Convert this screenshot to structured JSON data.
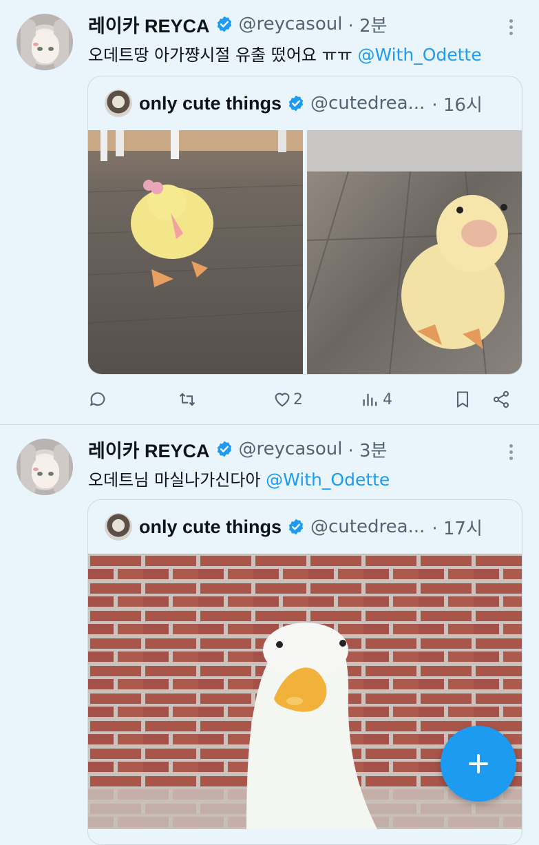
{
  "tweets": [
    {
      "display_name": "레이카 REYCA",
      "handle": "@reycasoul",
      "time": "· 2분",
      "text": "오데트땅 아가쨩시절 유출 떴어요 ㅠㅠ ",
      "mention": "@With_Odette",
      "quote": {
        "display_name": "only cute things",
        "handle": "@cutedrea...",
        "time": "· 16시",
        "images": [
          "duckling-with-pink-bow",
          "duckling-closeup"
        ]
      },
      "actions": {
        "reply_icon": "reply-icon",
        "retweet_icon": "retweet-icon",
        "like_icon": "like-icon",
        "like_count": "2",
        "views_icon": "views-icon",
        "views_count": "4",
        "bookmark_icon": "bookmark-icon",
        "share_icon": "share-icon"
      }
    },
    {
      "display_name": "레이카 REYCA",
      "handle": "@reycasoul",
      "time": "· 3분",
      "text": "오데트님 마실나가신다아 ",
      "mention": "@With_Odette",
      "quote": {
        "display_name": "only cute things",
        "handle": "@cutedrea...",
        "time": "· 17시",
        "images": [
          "white-duck-brick-wall"
        ]
      }
    }
  ],
  "fab_icon": "plus-icon",
  "colors": {
    "accent": "#1d9bf0",
    "background": "#e9f4fb",
    "muted": "#536471"
  }
}
